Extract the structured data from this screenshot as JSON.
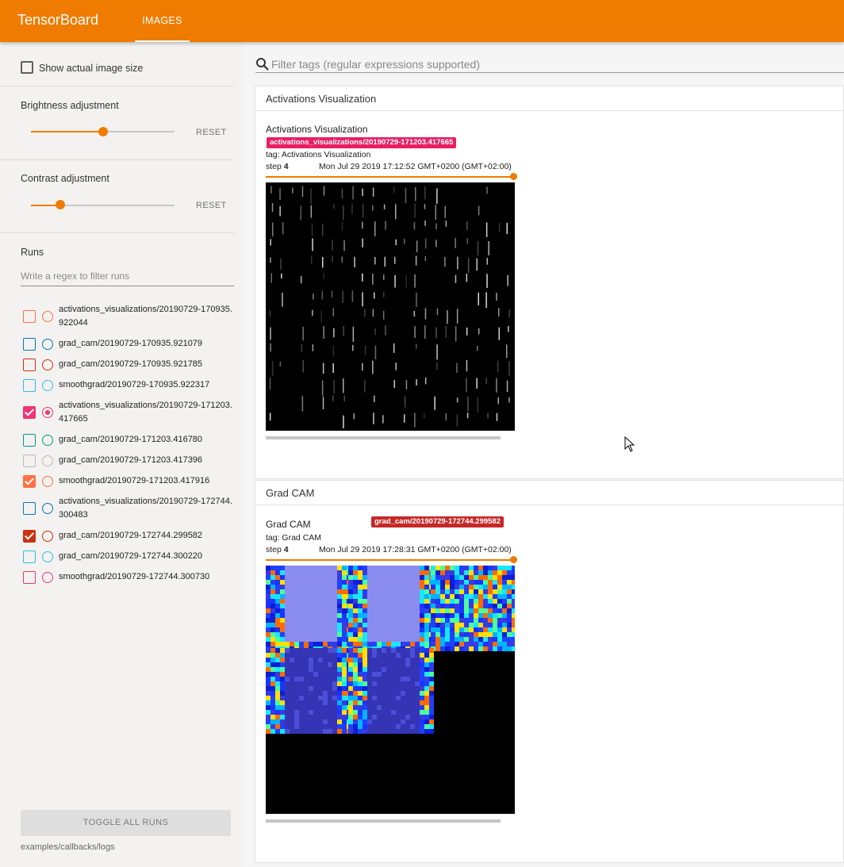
{
  "app": {
    "brand": "TensorBoard",
    "active_tab": "IMAGES"
  },
  "sidebar": {
    "show_actual_size": {
      "label": "Show actual image size",
      "checked": false
    },
    "brightness": {
      "title": "Brightness adjustment",
      "reset": "RESET",
      "value_fraction": 0.5
    },
    "contrast": {
      "title": "Contrast adjustment",
      "reset": "RESET",
      "value_fraction": 0.2
    },
    "runs_title": "Runs",
    "runs_filter_placeholder": "Write a regex to filter runs",
    "runs": [
      {
        "name": "activations_visualizations/20190729-170935.922044",
        "color": "#ff7043",
        "checked": false,
        "selected": false
      },
      {
        "name": "grad_cam/20190729-170935.921079",
        "color": "#0077bb",
        "checked": false,
        "selected": false
      },
      {
        "name": "grad_cam/20190729-170935.921785",
        "color": "#cc3311",
        "checked": false,
        "selected": false
      },
      {
        "name": "smoothgrad/20190729-170935.922317",
        "color": "#33bbee",
        "checked": false,
        "selected": false
      },
      {
        "name": "activations_visualizations/20190729-171203.417665",
        "color": "#ee3377",
        "checked": true,
        "selected": true
      },
      {
        "name": "grad_cam/20190729-171203.416780",
        "color": "#009988",
        "checked": false,
        "selected": false
      },
      {
        "name": "grad_cam/20190729-171203.417396",
        "color": "#bbbbbb",
        "checked": false,
        "selected": false
      },
      {
        "name": "smoothgrad/20190729-171203.417916",
        "color": "#ff7043",
        "checked": true,
        "selected": false
      },
      {
        "name": "activations_visualizations/20190729-172744.300483",
        "color": "#0077bb",
        "checked": false,
        "selected": false
      },
      {
        "name": "grad_cam/20190729-172744.299582",
        "color": "#cc3311",
        "checked": true,
        "selected": false
      },
      {
        "name": "grad_cam/20190729-172744.300220",
        "color": "#33bbee",
        "checked": false,
        "selected": false
      },
      {
        "name": "smoothgrad/20190729-172744.300730",
        "color": "#ee3377",
        "checked": false,
        "selected": false
      }
    ],
    "toggle_all": "TOGGLE ALL RUNS",
    "logdir": "examples/callbacks/logs"
  },
  "main": {
    "filter_placeholder": "Filter tags (regular expressions supported)",
    "cards": [
      {
        "header": "Activations Visualization",
        "pane_title": "Activations Visualization",
        "run": "activations_visualizations/20190729-171203.417665",
        "run_color": "#e91e63",
        "tag": "tag: Activations Visualization",
        "step_label": "step",
        "step": "4",
        "timestamp": "Mon Jul 29 2019 17:12:52 GMT+0200 (GMT+02:00)",
        "step_fraction": 1.0
      },
      {
        "header": "Grad CAM",
        "pane_title": "Grad CAM",
        "run": "grad_cam/20190729-172744.299582",
        "run_color": "#c62828",
        "tag": "tag: Grad CAM",
        "step_label": "step",
        "step": "4",
        "timestamp": "Mon Jul 29 2019 17:28:31 GMT+0200 (GMT+02:00)",
        "step_fraction": 1.0
      }
    ]
  },
  "icons": {
    "search": "search-icon",
    "cursor": "mouse-cursor-icon"
  }
}
